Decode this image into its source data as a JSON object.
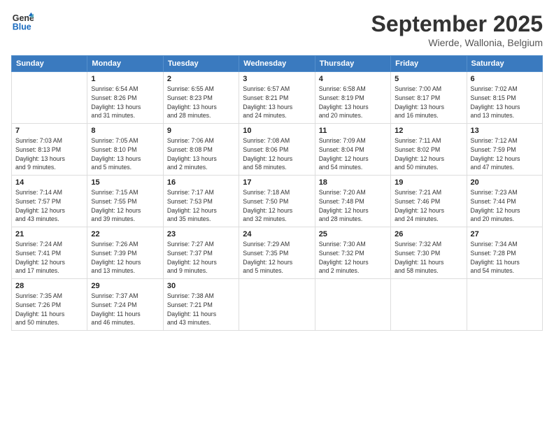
{
  "logo": {
    "line1": "General",
    "line2": "Blue"
  },
  "title": "September 2025",
  "subtitle": "Wierde, Wallonia, Belgium",
  "weekdays": [
    "Sunday",
    "Monday",
    "Tuesday",
    "Wednesday",
    "Thursday",
    "Friday",
    "Saturday"
  ],
  "weeks": [
    [
      {
        "day": "",
        "info": ""
      },
      {
        "day": "1",
        "info": "Sunrise: 6:54 AM\nSunset: 8:26 PM\nDaylight: 13 hours\nand 31 minutes."
      },
      {
        "day": "2",
        "info": "Sunrise: 6:55 AM\nSunset: 8:23 PM\nDaylight: 13 hours\nand 28 minutes."
      },
      {
        "day": "3",
        "info": "Sunrise: 6:57 AM\nSunset: 8:21 PM\nDaylight: 13 hours\nand 24 minutes."
      },
      {
        "day": "4",
        "info": "Sunrise: 6:58 AM\nSunset: 8:19 PM\nDaylight: 13 hours\nand 20 minutes."
      },
      {
        "day": "5",
        "info": "Sunrise: 7:00 AM\nSunset: 8:17 PM\nDaylight: 13 hours\nand 16 minutes."
      },
      {
        "day": "6",
        "info": "Sunrise: 7:02 AM\nSunset: 8:15 PM\nDaylight: 13 hours\nand 13 minutes."
      }
    ],
    [
      {
        "day": "7",
        "info": "Sunrise: 7:03 AM\nSunset: 8:13 PM\nDaylight: 13 hours\nand 9 minutes."
      },
      {
        "day": "8",
        "info": "Sunrise: 7:05 AM\nSunset: 8:10 PM\nDaylight: 13 hours\nand 5 minutes."
      },
      {
        "day": "9",
        "info": "Sunrise: 7:06 AM\nSunset: 8:08 PM\nDaylight: 13 hours\nand 2 minutes."
      },
      {
        "day": "10",
        "info": "Sunrise: 7:08 AM\nSunset: 8:06 PM\nDaylight: 12 hours\nand 58 minutes."
      },
      {
        "day": "11",
        "info": "Sunrise: 7:09 AM\nSunset: 8:04 PM\nDaylight: 12 hours\nand 54 minutes."
      },
      {
        "day": "12",
        "info": "Sunrise: 7:11 AM\nSunset: 8:02 PM\nDaylight: 12 hours\nand 50 minutes."
      },
      {
        "day": "13",
        "info": "Sunrise: 7:12 AM\nSunset: 7:59 PM\nDaylight: 12 hours\nand 47 minutes."
      }
    ],
    [
      {
        "day": "14",
        "info": "Sunrise: 7:14 AM\nSunset: 7:57 PM\nDaylight: 12 hours\nand 43 minutes."
      },
      {
        "day": "15",
        "info": "Sunrise: 7:15 AM\nSunset: 7:55 PM\nDaylight: 12 hours\nand 39 minutes."
      },
      {
        "day": "16",
        "info": "Sunrise: 7:17 AM\nSunset: 7:53 PM\nDaylight: 12 hours\nand 35 minutes."
      },
      {
        "day": "17",
        "info": "Sunrise: 7:18 AM\nSunset: 7:50 PM\nDaylight: 12 hours\nand 32 minutes."
      },
      {
        "day": "18",
        "info": "Sunrise: 7:20 AM\nSunset: 7:48 PM\nDaylight: 12 hours\nand 28 minutes."
      },
      {
        "day": "19",
        "info": "Sunrise: 7:21 AM\nSunset: 7:46 PM\nDaylight: 12 hours\nand 24 minutes."
      },
      {
        "day": "20",
        "info": "Sunrise: 7:23 AM\nSunset: 7:44 PM\nDaylight: 12 hours\nand 20 minutes."
      }
    ],
    [
      {
        "day": "21",
        "info": "Sunrise: 7:24 AM\nSunset: 7:41 PM\nDaylight: 12 hours\nand 17 minutes."
      },
      {
        "day": "22",
        "info": "Sunrise: 7:26 AM\nSunset: 7:39 PM\nDaylight: 12 hours\nand 13 minutes."
      },
      {
        "day": "23",
        "info": "Sunrise: 7:27 AM\nSunset: 7:37 PM\nDaylight: 12 hours\nand 9 minutes."
      },
      {
        "day": "24",
        "info": "Sunrise: 7:29 AM\nSunset: 7:35 PM\nDaylight: 12 hours\nand 5 minutes."
      },
      {
        "day": "25",
        "info": "Sunrise: 7:30 AM\nSunset: 7:32 PM\nDaylight: 12 hours\nand 2 minutes."
      },
      {
        "day": "26",
        "info": "Sunrise: 7:32 AM\nSunset: 7:30 PM\nDaylight: 11 hours\nand 58 minutes."
      },
      {
        "day": "27",
        "info": "Sunrise: 7:34 AM\nSunset: 7:28 PM\nDaylight: 11 hours\nand 54 minutes."
      }
    ],
    [
      {
        "day": "28",
        "info": "Sunrise: 7:35 AM\nSunset: 7:26 PM\nDaylight: 11 hours\nand 50 minutes."
      },
      {
        "day": "29",
        "info": "Sunrise: 7:37 AM\nSunset: 7:24 PM\nDaylight: 11 hours\nand 46 minutes."
      },
      {
        "day": "30",
        "info": "Sunrise: 7:38 AM\nSunset: 7:21 PM\nDaylight: 11 hours\nand 43 minutes."
      },
      {
        "day": "",
        "info": ""
      },
      {
        "day": "",
        "info": ""
      },
      {
        "day": "",
        "info": ""
      },
      {
        "day": "",
        "info": ""
      }
    ]
  ]
}
